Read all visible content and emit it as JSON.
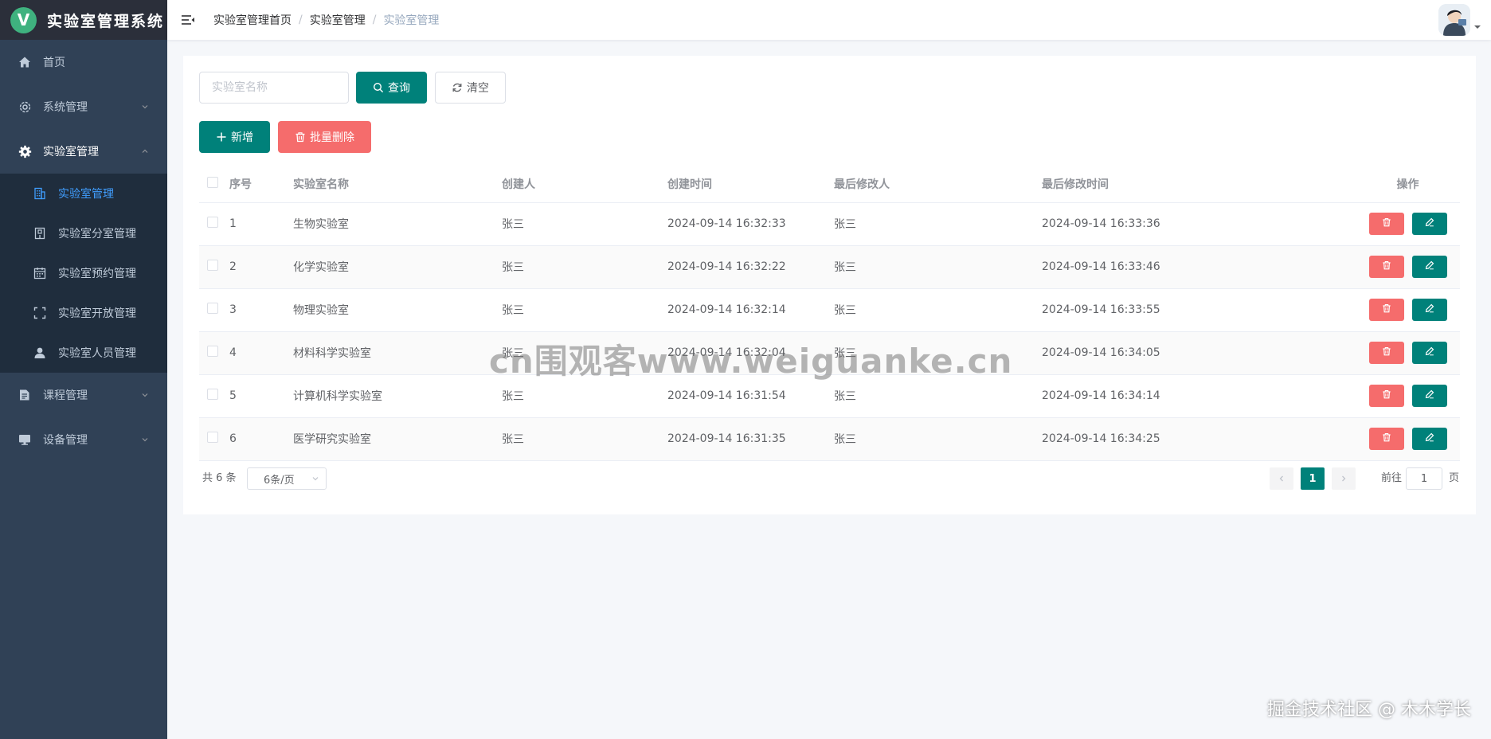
{
  "app": {
    "title": "实验室管理系统",
    "logo_letter": "V"
  },
  "sidebar": {
    "items": [
      {
        "label": "首页",
        "icon": "home-icon"
      },
      {
        "label": "系统管理",
        "icon": "gear-outline-icon"
      },
      {
        "label": "实验室管理",
        "icon": "gear-icon"
      },
      {
        "label": "课程管理",
        "icon": "document-icon"
      },
      {
        "label": "设备管理",
        "icon": "monitor-icon"
      }
    ],
    "sub_items": [
      {
        "label": "实验室管理",
        "icon": "building-icon"
      },
      {
        "label": "实验室分室管理",
        "icon": "office-icon"
      },
      {
        "label": "实验室预约管理",
        "icon": "calendar-icon"
      },
      {
        "label": "实验室开放管理",
        "icon": "fullscreen-icon"
      },
      {
        "label": "实验室人员管理",
        "icon": "user-icon"
      }
    ]
  },
  "breadcrumb": [
    "实验室管理首页",
    "实验室管理",
    "实验室管理"
  ],
  "search": {
    "placeholder": "实验室名称",
    "query_label": "查询",
    "clear_label": "清空"
  },
  "toolbar": {
    "add_label": "新增",
    "bulk_delete_label": "批量删除"
  },
  "table": {
    "headers": [
      "序号",
      "实验室名称",
      "创建人",
      "创建时间",
      "最后修改人",
      "最后修改时间",
      "操作"
    ],
    "rows": [
      {
        "no": "1",
        "name": "生物实验室",
        "creator": "张三",
        "created": "2024-09-14 16:32:33",
        "modifier": "张三",
        "modified": "2024-09-14 16:33:36"
      },
      {
        "no": "2",
        "name": "化学实验室",
        "creator": "张三",
        "created": "2024-09-14 16:32:22",
        "modifier": "张三",
        "modified": "2024-09-14 16:33:46"
      },
      {
        "no": "3",
        "name": "物理实验室",
        "creator": "张三",
        "created": "2024-09-14 16:32:14",
        "modifier": "张三",
        "modified": "2024-09-14 16:33:55"
      },
      {
        "no": "4",
        "name": "材料科学实验室",
        "creator": "张三",
        "created": "2024-09-14 16:32:04",
        "modifier": "张三",
        "modified": "2024-09-14 16:34:05"
      },
      {
        "no": "5",
        "name": "计算机科学实验室",
        "creator": "张三",
        "created": "2024-09-14 16:31:54",
        "modifier": "张三",
        "modified": "2024-09-14 16:34:14"
      },
      {
        "no": "6",
        "name": "医学研究实验室",
        "creator": "张三",
        "created": "2024-09-14 16:31:35",
        "modifier": "张三",
        "modified": "2024-09-14 16:34:25"
      }
    ]
  },
  "pagination": {
    "total": "共 6 条",
    "page_size": "6条/页",
    "current": "1",
    "goto_label": "前往",
    "goto_value": "1",
    "goto_suffix": "页"
  },
  "watermark": "cn围观客www.weiguanke.cn",
  "credit": "掘金技术社区 @ 木木学长",
  "colors": {
    "primary": "#00817a",
    "danger": "#f56c6c",
    "sidebar": "#304156",
    "submenu": "#1f2d3d",
    "active_link": "#409eff"
  }
}
